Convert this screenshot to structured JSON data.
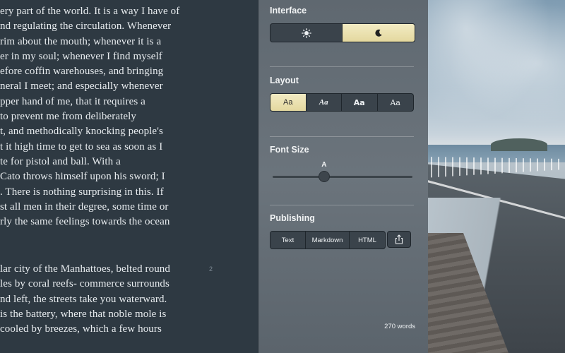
{
  "editor": {
    "paragraph1": [
      "ery part of the world. It is a way I have of",
      "nd regulating the circulation. Whenever",
      "rim about the mouth; whenever it is a",
      "er in my soul; whenever I find myself",
      "efore coffin warehouses, and bringing",
      "neral I meet; and especially whenever",
      "pper hand of me, that it requires a",
      "to prevent me from deliberately",
      "t, and methodically knocking people's",
      "t it high time to get to sea as soon as I",
      "te for pistol and ball. With a",
      "Cato throws himself upon his sword; I",
      ". There is nothing surprising in this. If",
      "st all men in their degree, some time or",
      "rly the same feelings towards the ocean"
    ],
    "paragraph2": [
      "lar city of the Manhattoes, belted round",
      "les by coral reefs- commerce surrounds",
      "nd left, the streets take you waterward.",
      " is the battery, where that noble mole is",
      "cooled by breezes, which a few hours"
    ],
    "gutter_number": "2"
  },
  "panel": {
    "interface": {
      "title": "Interface",
      "options": [
        {
          "icon": "sun-icon",
          "selected": false
        },
        {
          "icon": "moon-icon",
          "selected": true
        }
      ]
    },
    "layout": {
      "title": "Layout",
      "options": [
        {
          "label": "Aa",
          "selected": true
        },
        {
          "label": "Aa",
          "selected": false
        },
        {
          "label": "Aa",
          "selected": false
        },
        {
          "label": "Aa",
          "selected": false
        }
      ]
    },
    "font_size": {
      "title": "Font Size",
      "marker": "A",
      "value": 0.37
    },
    "publishing": {
      "title": "Publishing",
      "options": [
        "Text",
        "Markdown",
        "HTML"
      ],
      "share_icon": "share-icon"
    },
    "word_count": "270 words"
  },
  "colors": {
    "selected_segment": "#ede3b3",
    "panel_bg": "#646d75",
    "editor_bg": "#2e3942"
  }
}
